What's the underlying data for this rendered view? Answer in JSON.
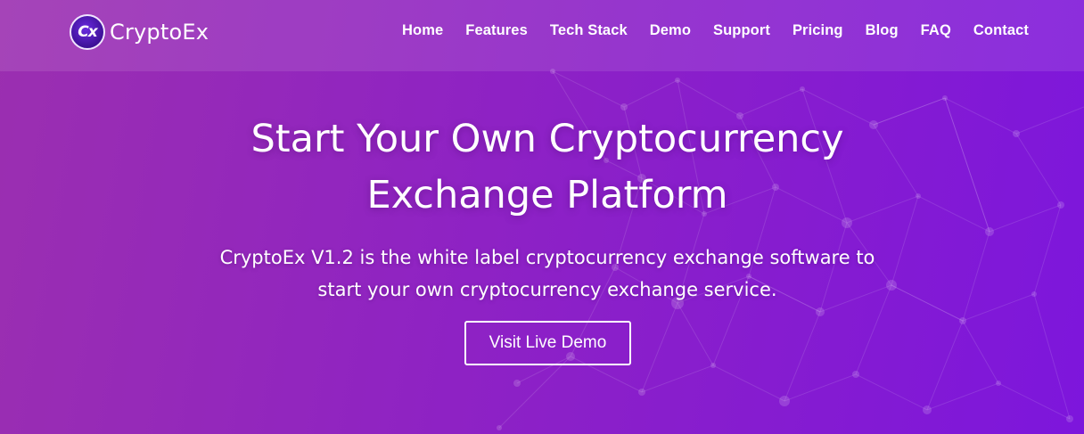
{
  "brand": {
    "logo_mark": "Cx",
    "name": "CryptoEx"
  },
  "nav": {
    "items": [
      {
        "label": "Home"
      },
      {
        "label": "Features"
      },
      {
        "label": "Tech Stack"
      },
      {
        "label": "Demo"
      },
      {
        "label": "Support"
      },
      {
        "label": "Pricing"
      },
      {
        "label": "Blog"
      },
      {
        "label": "FAQ"
      },
      {
        "label": "Contact"
      }
    ]
  },
  "hero": {
    "title_line1": "Start Your Own Cryptocurrency",
    "title_line2": "Exchange Platform",
    "subtitle_line1": "CryptoEx V1.2 is the white label cryptocurrency exchange software to",
    "subtitle_line2": "start your own cryptocurrency exchange service.",
    "cta_label": "Visit Live Demo"
  },
  "colors": {
    "gradient_start": "#9b2fb0",
    "gradient_end": "#7d16dc",
    "text": "#ffffff"
  }
}
